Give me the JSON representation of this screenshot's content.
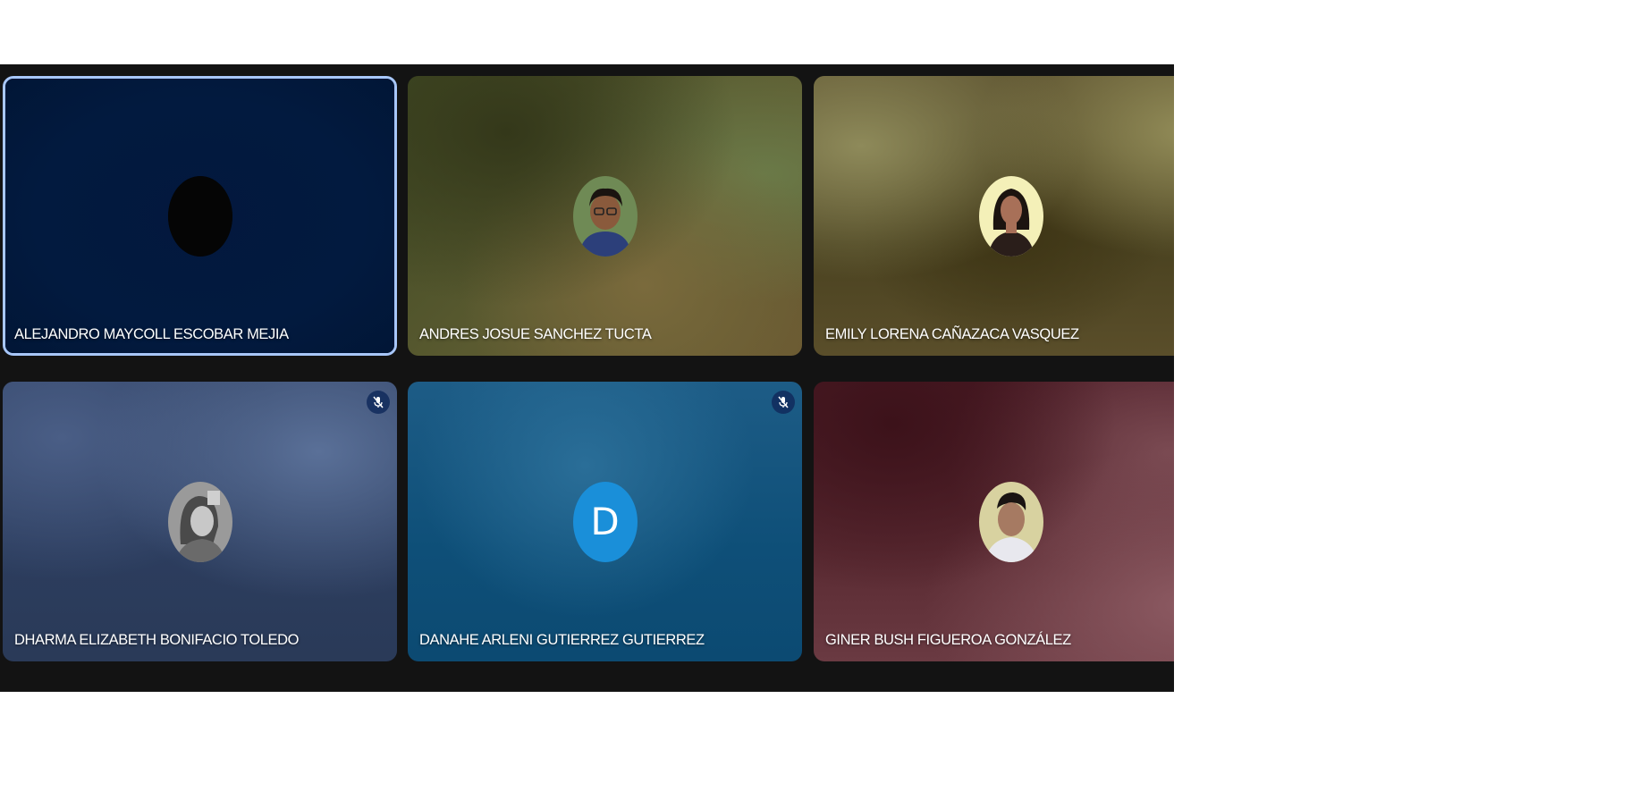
{
  "meeting": {
    "participants": [
      {
        "name": "ALEJANDRO MAYCOLL ESCOBAR MEJIA",
        "avatar_icon": "blank-avatar",
        "muted": false,
        "active_speaker": true
      },
      {
        "name": "ANDRES JOSUE SANCHEZ TUCTA",
        "avatar_icon": "profile-photo",
        "muted": false,
        "active_speaker": false
      },
      {
        "name": "EMILY LORENA CAÑAZACA VASQUEZ",
        "avatar_icon": "profile-photo",
        "muted": false,
        "active_speaker": false
      },
      {
        "name": "DHARMA ELIZABETH BONIFACIO TOLEDO",
        "avatar_icon": "profile-photo",
        "muted": true,
        "active_speaker": false
      },
      {
        "name": "DANAHE ARLENI GUTIERREZ GUTIERREZ",
        "avatar_letter": "D",
        "muted": true,
        "active_speaker": false
      },
      {
        "name": "GINER BUSH FIGUEROA GONZÁLEZ",
        "avatar_icon": "profile-photo",
        "muted": false,
        "active_speaker": false
      }
    ]
  },
  "colors": {
    "stage_background": "#131313",
    "active_speaker_border": "#a8c7fa",
    "letter_avatar": "#1a8fd9"
  }
}
